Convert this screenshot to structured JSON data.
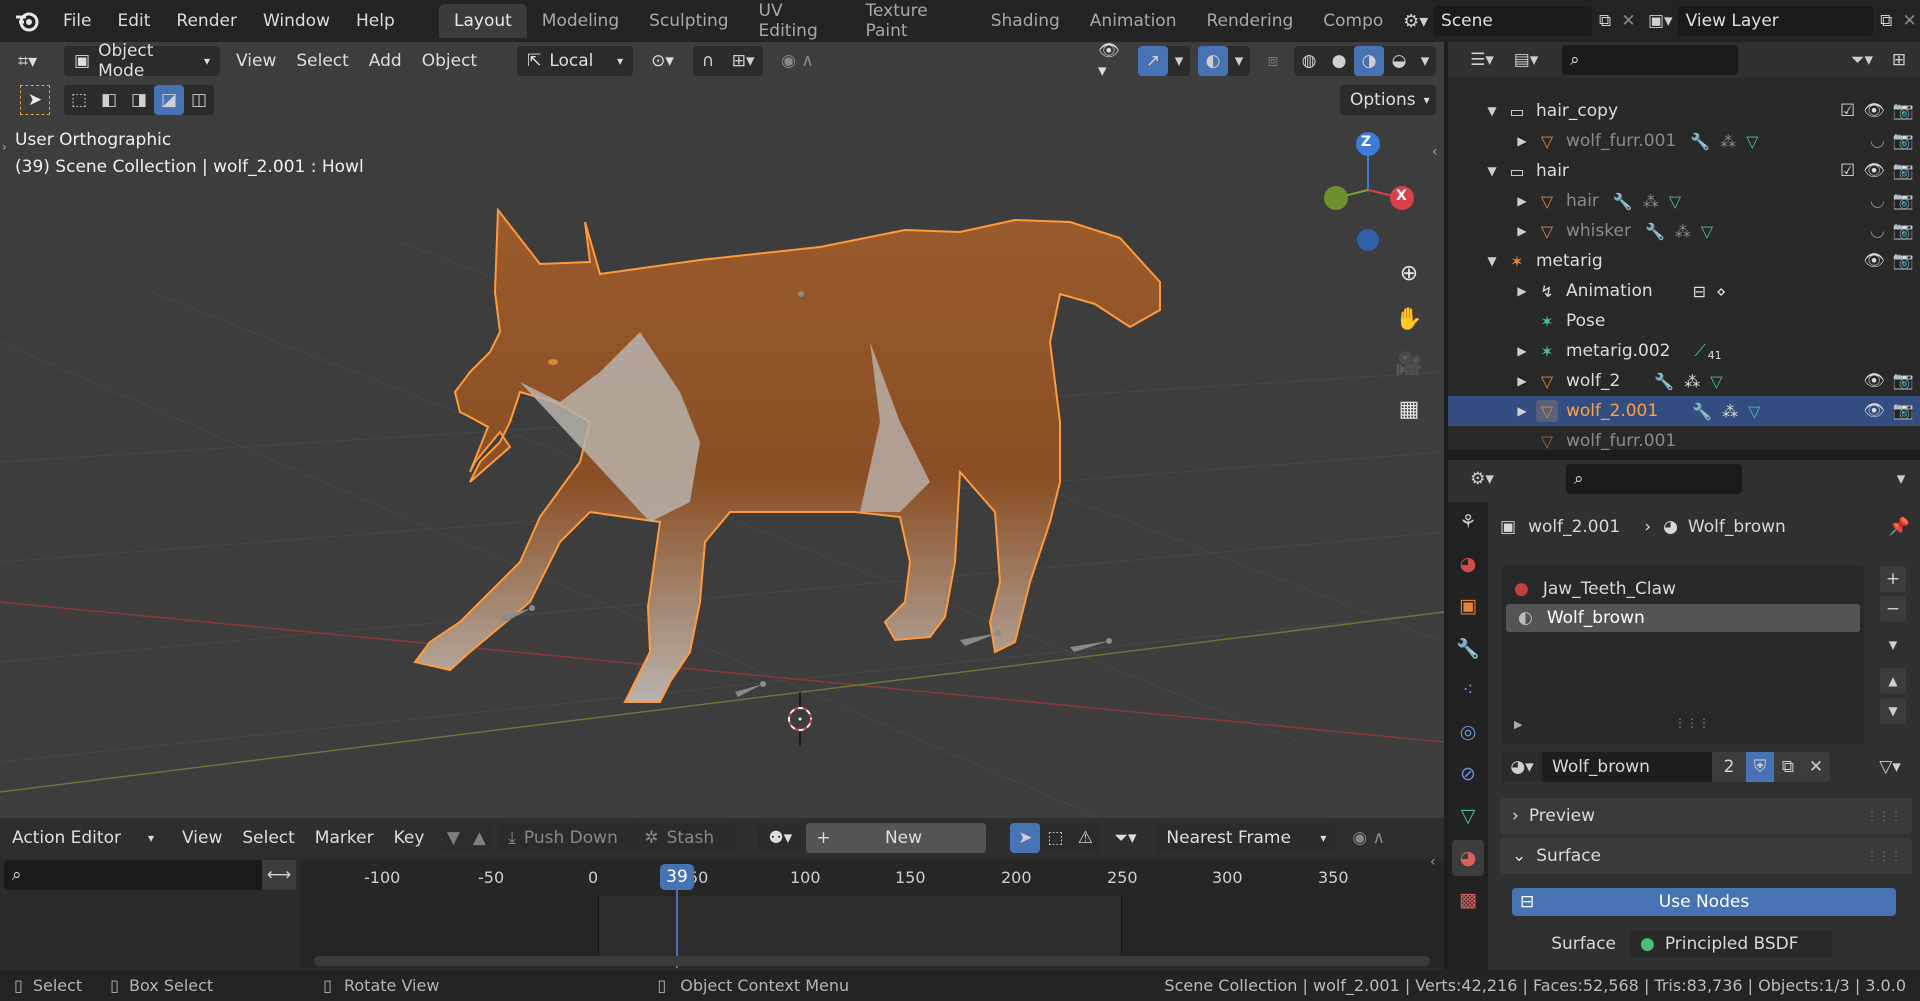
{
  "topbar": {
    "menus": [
      "File",
      "Edit",
      "Render",
      "Window",
      "Help"
    ],
    "workspaces": [
      "Layout",
      "Modeling",
      "Sculpting",
      "UV Editing",
      "Texture Paint",
      "Shading",
      "Animation",
      "Rendering",
      "Compo"
    ],
    "active_workspace": "Layout",
    "scene": "Scene",
    "view_layer": "View Layer"
  },
  "viewport": {
    "mode": "Object Mode",
    "menus": [
      "View",
      "Select",
      "Add",
      "Object"
    ],
    "transform_orientation": "Local",
    "options_label": "Options",
    "view_name": "User Orthographic",
    "context_line": "(39) Scene Collection | wolf_2.001 : Howl",
    "gizmo_axes": [
      "Z",
      "X"
    ],
    "accent_color": "#e8843a"
  },
  "outliner": {
    "rows": [
      {
        "label": "hair_copy",
        "type": "collection",
        "level": 0,
        "expanded": true,
        "checkbox": true,
        "dim": false
      },
      {
        "label": "wolf_furr.001",
        "type": "mesh",
        "level": 1,
        "dim": true
      },
      {
        "label": "hair",
        "type": "collection",
        "level": 0,
        "expanded": true,
        "checkbox": true,
        "dim": false
      },
      {
        "label": "hair",
        "type": "mesh",
        "level": 1,
        "dim": true
      },
      {
        "label": "whisker",
        "type": "mesh",
        "level": 1,
        "dim": true
      },
      {
        "label": "metarig",
        "type": "armature",
        "level": 0,
        "expanded": true,
        "dim": false
      },
      {
        "label": "Animation",
        "type": "animation",
        "level": 1,
        "dim": false
      },
      {
        "label": "Pose",
        "type": "pose",
        "level": 1,
        "dim": false
      },
      {
        "label": "metarig.002",
        "type": "armature-data",
        "level": 1,
        "dim": false,
        "badge": "41"
      },
      {
        "label": "wolf_2",
        "type": "mesh",
        "level": 1,
        "dim": false
      },
      {
        "label": "wolf_2.001",
        "type": "mesh",
        "level": 1,
        "dim": false,
        "selected": true
      },
      {
        "label": "wolf_furr.001",
        "type": "mesh",
        "level": 1,
        "dim": true
      }
    ]
  },
  "properties": {
    "breadcrumb_object": "wolf_2.001",
    "breadcrumb_material": "Wolf_brown",
    "material_slots": [
      "Jaw_Teeth_Claw",
      "Wolf_brown"
    ],
    "selected_slot": "Wolf_brown",
    "material_name": "Wolf_brown",
    "user_count": "2",
    "panels": [
      "Preview",
      "Surface"
    ],
    "use_nodes_label": "Use Nodes",
    "surface_label": "Surface",
    "surface_value": "Principled BSDF"
  },
  "timeline": {
    "editor": "Action Editor",
    "menus": [
      "View",
      "Select",
      "Marker",
      "Key"
    ],
    "push_down": "Push Down",
    "stash": "Stash",
    "new_label": "New",
    "snap": "Nearest Frame",
    "current_frame": "39",
    "ticks": [
      "-100",
      "-50",
      "0",
      "50",
      "100",
      "150",
      "200",
      "250",
      "300",
      "350"
    ]
  },
  "statusbar": {
    "select": "Select",
    "box_select": "Box Select",
    "rotate": "Rotate View",
    "context_menu": "Object Context Menu",
    "stats": "Scene Collection | wolf_2.001 | Verts:42,216 | Faces:52,568 | Tris:83,736 | Objects:1/3 | 3.0.0"
  }
}
